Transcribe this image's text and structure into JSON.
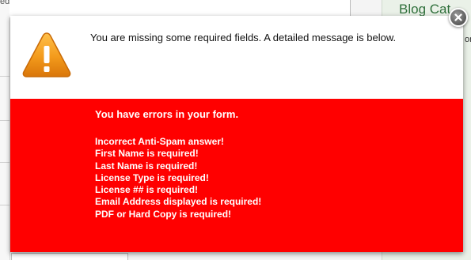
{
  "background": {
    "top_left_fragment": "ed",
    "right_panel_title": "Blog Cat",
    "right_panel_fragment": "or"
  },
  "dialog": {
    "header_message": "You are missing some required fields. A detailed message is below.",
    "error_title": "You have errors in your form.",
    "errors": [
      "Incorrect Anti-Spam answer!",
      "First Name is required!",
      "Last Name is required!",
      "License Type is required!",
      "License ## is required!",
      "Email Address displayed is required!",
      "PDF or Hard Copy is required!"
    ],
    "close_icon": "close-icon",
    "warning_icon": "warning-icon"
  },
  "colors": {
    "error_background": "#ff0000",
    "error_text": "#ffffff",
    "warning_orange": "#f39a1b"
  }
}
